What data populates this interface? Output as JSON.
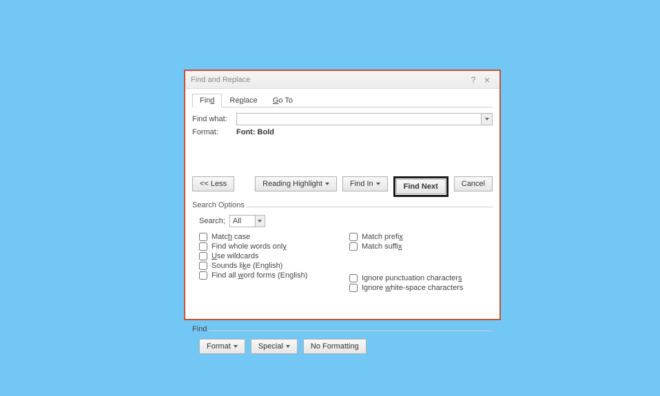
{
  "dialog": {
    "title": "Find and Replace",
    "help_symbol": "?",
    "close_symbol": "×"
  },
  "tabs": {
    "find_pre": "Fin",
    "find_ul": "d",
    "replace_pre": "Re",
    "replace_ul": "p",
    "replace_post": "lace",
    "goto_ul": "G",
    "goto_post": "o To"
  },
  "labels": {
    "find_what": "Find what:",
    "format": "Format:",
    "format_value": "Font: Bold"
  },
  "buttons": {
    "less": "<< Less",
    "reading_highlight": "Reading Highlight",
    "find_in": "Find In",
    "find_next": "Find Next",
    "cancel": "Cancel",
    "format_btn": "Format",
    "special": "Special",
    "no_formatting": "No Formatting"
  },
  "search_options": {
    "legend": "Search Options",
    "search_label": "Search;",
    "search_value": "All",
    "match_case_pre": "Matc",
    "match_case_ul": "h",
    "match_case_post": " case",
    "whole_words_pre": "Find whole words onl",
    "whole_words_ul": "y",
    "wildcards_ul": "U",
    "wildcards_post": "se wildcards",
    "sounds_like_pre": "Sounds li",
    "sounds_like_ul": "k",
    "sounds_like_post": "e (English)",
    "word_forms_pre": "Find all ",
    "word_forms_ul": "w",
    "word_forms_post": "ord forms (English)",
    "match_prefix_pre": "Match prefi",
    "match_prefix_ul": "x",
    "match_suffix_pre": "Match suffi",
    "match_suffix_ul": "x",
    "ignore_punct_pre": "Ignore punctuation character",
    "ignore_punct_ul": "s",
    "ignore_ws_pre": "Ignore ",
    "ignore_ws_ul": "w",
    "ignore_ws_post": "hite-space characters"
  },
  "find_section_label": "Find"
}
